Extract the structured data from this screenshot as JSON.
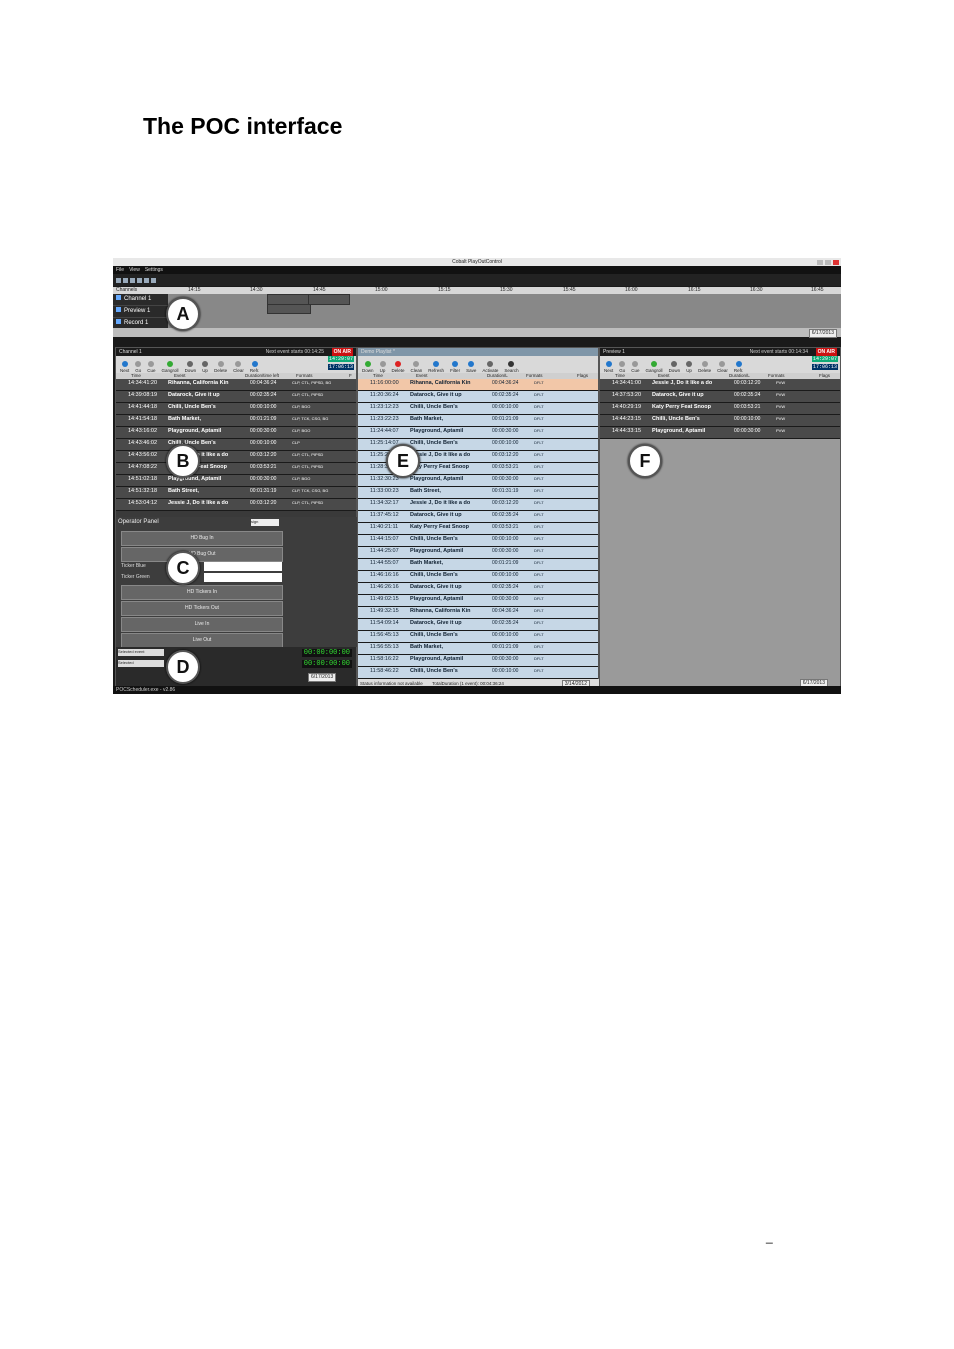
{
  "doc_title": "The POC interface",
  "page_mark": "_",
  "screenshot": {
    "window_title": "Cobalt PlayOutControl",
    "menu": [
      "File",
      "View",
      "Settings"
    ],
    "timeline": {
      "label": "Channels",
      "ticks": [
        "14:15",
        "14:30",
        "14:45",
        "15:00",
        "15:15",
        "15:30",
        "15:45",
        "16:00",
        "16:15",
        "16:30",
        "16:45"
      ],
      "channels": [
        "Channel 1",
        "Preview 1",
        "Record 1"
      ],
      "date": "6/17/2013"
    },
    "left_panel": {
      "title": "Channel 1",
      "next_event": "Next event starts 00:14:25",
      "on_air": "ON AIR",
      "clock_top": "14:29:07",
      "clock_bottom": "17:06:13",
      "tools": [
        "Next",
        "Go",
        "Cue",
        "Gangroll",
        "Down",
        "Up",
        "Delete",
        "Clear",
        "Refr."
      ],
      "columns": [
        "Time",
        "Event",
        "Duration/time left",
        "Formats",
        "F"
      ],
      "rows": [
        {
          "time": "14:34:41:20",
          "event": "Rihanna, California Kin",
          "duration": "00:04:36:24",
          "formats": "CLP, CTL, PIPSD, BG"
        },
        {
          "time": "14:39:08:19",
          "event": "Datarock, Give it up",
          "duration": "00:02:35:24",
          "formats": "CLP, CTL, PIPSD"
        },
        {
          "time": "14:41:44:18",
          "event": "Chilli, Uncle Ben's",
          "duration": "00:00:10:00",
          "formats": "CLP, BGO"
        },
        {
          "time": "14:41:54:18",
          "event": "Bath Market,",
          "duration": "00:01:21:09",
          "formats": "CLP, TCK, CSG, BG"
        },
        {
          "time": "14:43:16:02",
          "event": "Playground, Aptamil",
          "duration": "00:00:30:00",
          "formats": "CLP, BGO"
        },
        {
          "time": "14:43:46:02",
          "event": "Chilli, Uncle Ben's",
          "duration": "00:00:10:00",
          "formats": "CLP"
        },
        {
          "time": "14:43:56:02",
          "event": "Jessie J, Do it like a do",
          "duration": "00:03:12:20",
          "formats": "CLP, CTL, PIPSD"
        },
        {
          "time": "14:47:08:22",
          "event": "Katy Perry Feat Snoop",
          "duration": "00:03:53:21",
          "formats": "CLP, CTL, PIPSD"
        },
        {
          "time": "14:51:02:18",
          "event": "Playground, Aptamil",
          "duration": "00:00:30:00",
          "formats": "CLP, BGO"
        },
        {
          "time": "14:51:32:18",
          "event": "Bath Street,",
          "duration": "00:01:31:19",
          "formats": "CLP, TCK, CSG, BG"
        },
        {
          "time": "14:53:04:12",
          "event": "Jessie J, Do it like a do",
          "duration": "00:03:12:20",
          "formats": "CLP, CTL, PIPSD"
        }
      ],
      "operator_panel": {
        "title": "Operator Panel",
        "select": "sign",
        "buttons": [
          "HD Bug In",
          "HD Bug Out",
          "HD Tickers In",
          "HD Tickers Out",
          "Live In",
          "Live Out"
        ],
        "ticker_blue": "Ticker Blue",
        "ticker_green": "Ticker Green",
        "selected_event": "Selected event",
        "selected": "Selected",
        "timecode1": "00:00:00:00",
        "timecode2": "00:00:00:00"
      },
      "date": "6/17/2013"
    },
    "mid_panel": {
      "title": "Demo Playlist *",
      "tools": [
        "Down",
        "Up",
        "Delete",
        "Clean",
        "Refresh",
        "Filter",
        "Save",
        "Activate",
        "Search"
      ],
      "columns": [
        "Time",
        "Event",
        "Duration/L",
        "Formats",
        "Flags"
      ],
      "rows": [
        {
          "time": "11:16:00:00",
          "event": "Rihanna, California Kin",
          "duration": "00:04:36:24",
          "formats": "DFLT"
        },
        {
          "time": "11:20:36:24",
          "event": "Datarock, Give it up",
          "duration": "00:02:35:24",
          "formats": "DFLT"
        },
        {
          "time": "11:23:12:23",
          "event": "Chilli, Uncle Ben's",
          "duration": "00:00:10:00",
          "formats": "DFLT"
        },
        {
          "time": "11:23:22:23",
          "event": "Bath Market,",
          "duration": "00:01:21:09",
          "formats": "DFLT"
        },
        {
          "time": "11:24:44:07",
          "event": "Playground, Aptamil",
          "duration": "00:00:30:00",
          "formats": "DFLT"
        },
        {
          "time": "11:25:14:07",
          "event": "Chilli, Uncle Ben's",
          "duration": "00:00:10:00",
          "formats": "DFLT"
        },
        {
          "time": "11:25:24:07",
          "event": "Jessie J, Do it like a do",
          "duration": "00:03:12:20",
          "formats": "DFLT"
        },
        {
          "time": "11:28:36:27",
          "event": "Katy Perry Feat Snoop",
          "duration": "00:03:53:21",
          "formats": "DFLT"
        },
        {
          "time": "11:32:30:23",
          "event": "Playground, Aptamil",
          "duration": "00:00:30:00",
          "formats": "DFLT"
        },
        {
          "time": "11:33:00:23",
          "event": "Bath Street,",
          "duration": "00:01:31:19",
          "formats": "DFLT"
        },
        {
          "time": "11:34:32:17",
          "event": "Jessie J, Do it like a do",
          "duration": "00:03:12:20",
          "formats": "DFLT"
        },
        {
          "time": "11:37:45:12",
          "event": "Datarock, Give it up",
          "duration": "00:02:35:24",
          "formats": "DFLT"
        },
        {
          "time": "11:40:21:11",
          "event": "Katy Perry Feat Snoop",
          "duration": "00:03:53:21",
          "formats": "DFLT"
        },
        {
          "time": "11:44:15:07",
          "event": "Chilli, Uncle Ben's",
          "duration": "00:00:10:00",
          "formats": "DFLT"
        },
        {
          "time": "11:44:25:07",
          "event": "Playground, Aptamil",
          "duration": "00:00:30:00",
          "formats": "DFLT"
        },
        {
          "time": "11:44:55:07",
          "event": "Bath Market,",
          "duration": "00:01:21:09",
          "formats": "DFLT"
        },
        {
          "time": "11:46:16:16",
          "event": "Chilli, Uncle Ben's",
          "duration": "00:00:10:00",
          "formats": "DFLT"
        },
        {
          "time": "11:46:26:16",
          "event": "Datarock, Give it up",
          "duration": "00:02:35:24",
          "formats": "DFLT"
        },
        {
          "time": "11:49:02:15",
          "event": "Playground, Aptamil",
          "duration": "00:00:30:00",
          "formats": "DFLT"
        },
        {
          "time": "11:49:32:15",
          "event": "Rihanna, California Kin",
          "duration": "00:04:36:24",
          "formats": "DFLT"
        },
        {
          "time": "11:54:09:14",
          "event": "Datarock, Give it up",
          "duration": "00:02:35:24",
          "formats": "DFLT"
        },
        {
          "time": "11:56:45:13",
          "event": "Chilli, Uncle Ben's",
          "duration": "00:00:10:00",
          "formats": "DFLT"
        },
        {
          "time": "11:56:55:13",
          "event": "Bath Market,",
          "duration": "00:01:21:09",
          "formats": "DFLT"
        },
        {
          "time": "11:58:16:22",
          "event": "Playground, Aptamil",
          "duration": "00:00:30:00",
          "formats": "DFLT"
        },
        {
          "time": "11:58:46:22",
          "event": "Chilli, Uncle Ben's",
          "duration": "00:00:10:00",
          "formats": "DFLT"
        }
      ],
      "status": "Status information not available",
      "total": "TotalDuration (1 event): 00:04:36:24",
      "date": "3/14/2012"
    },
    "right_panel": {
      "title": "Preview 1",
      "next_event": "Next event starts 00:14:34",
      "on_air": "ON AIR",
      "clock_top": "14:29:07",
      "clock_bottom": "17:06:13",
      "tools": [
        "Next",
        "Go",
        "Cue",
        "Gangroll",
        "Down",
        "Up",
        "Delete",
        "Clear",
        "Refr."
      ],
      "columns": [
        "Time",
        "Event",
        "Duration/L",
        "Formats",
        "Flags"
      ],
      "rows": [
        {
          "time": "14:34:41:00",
          "event": "Jessie J, Do it like a do",
          "duration": "00:03:12:20",
          "formats": "PVW"
        },
        {
          "time": "14:37:53:20",
          "event": "Datarock, Give it up",
          "duration": "00:02:35:24",
          "formats": "PVW"
        },
        {
          "time": "14:40:29:19",
          "event": "Katy Perry Feat Snoop",
          "duration": "00:03:53:21",
          "formats": "PVW"
        },
        {
          "time": "14:44:23:15",
          "event": "Chilli, Uncle Ben's",
          "duration": "00:00:10:00",
          "formats": "PVW"
        },
        {
          "time": "14:44:33:15",
          "event": "Playground, Aptamil",
          "duration": "00:00:30:00",
          "formats": "PVW"
        }
      ],
      "date": "6/17/2013"
    },
    "status_bar": "POCScheduler.exe - v2.86",
    "callouts": [
      "A",
      "B",
      "C",
      "D",
      "E",
      "F"
    ]
  }
}
